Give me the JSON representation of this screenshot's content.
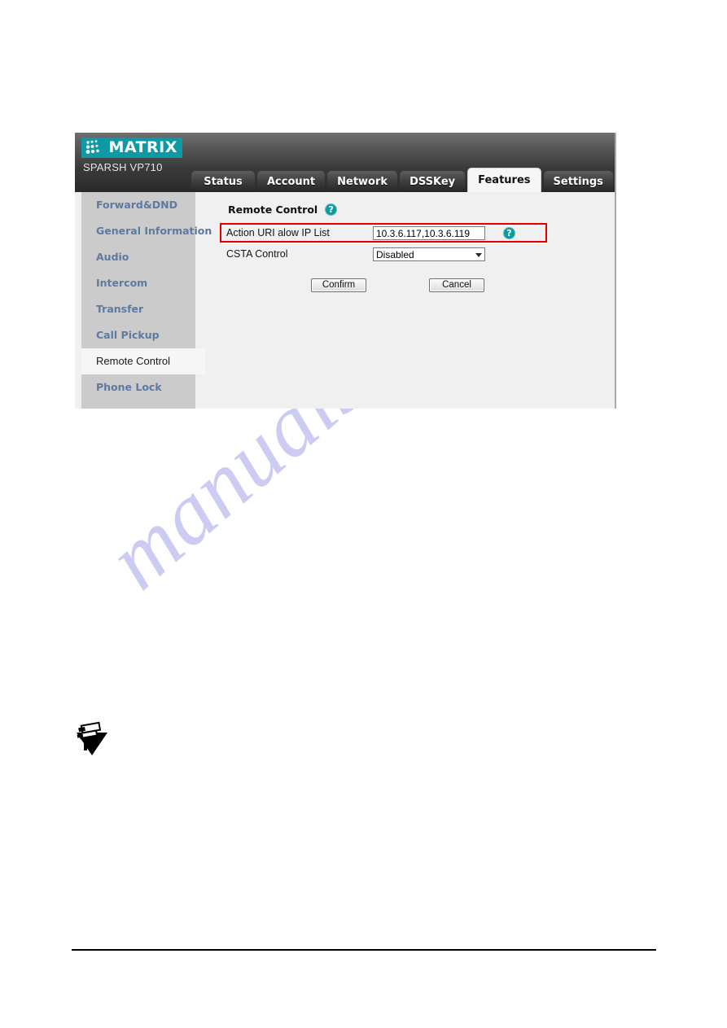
{
  "page": {
    "watermark_text": "manualshive.com",
    "watermark_color": "#b9b9ef"
  },
  "device_ui": {
    "brand": {
      "name": "MATRIX",
      "model": "SPARSH VP710",
      "logo_bg": "#0b9aa6",
      "logo_icon": "dot-grid-icon"
    },
    "tabs": [
      {
        "label": "Status",
        "active": false
      },
      {
        "label": "Account",
        "active": false
      },
      {
        "label": "Network",
        "active": false
      },
      {
        "label": "DSSKey",
        "active": false
      },
      {
        "label": "Features",
        "active": true
      },
      {
        "label": "Settings",
        "active": false
      }
    ],
    "sidebar": {
      "items": [
        {
          "label": "Forward&DND",
          "active": false
        },
        {
          "label": "General Information",
          "active": false
        },
        {
          "label": "Audio",
          "active": false
        },
        {
          "label": "Intercom",
          "active": false
        },
        {
          "label": "Transfer",
          "active": false
        },
        {
          "label": "Call Pickup",
          "active": false
        },
        {
          "label": "Remote Control",
          "active": true
        },
        {
          "label": "Phone Lock",
          "active": false
        }
      ]
    },
    "content": {
      "section_title": "Remote Control",
      "help_glyph": "?",
      "help_color": "#0e9aa3",
      "highlight_color": "#e00000",
      "fields": [
        {
          "label": "Action URI alow IP List",
          "value": "10.3.6.117,10.3.6.119",
          "type": "text",
          "highlighted": true,
          "has_help": true
        },
        {
          "label": "CSTA Control",
          "value": "Disabled",
          "type": "select",
          "highlighted": false,
          "has_help": false
        }
      ],
      "buttons": {
        "confirm": "Confirm",
        "cancel": "Cancel"
      }
    }
  },
  "note": {
    "icon": "note-triangle-icon"
  }
}
